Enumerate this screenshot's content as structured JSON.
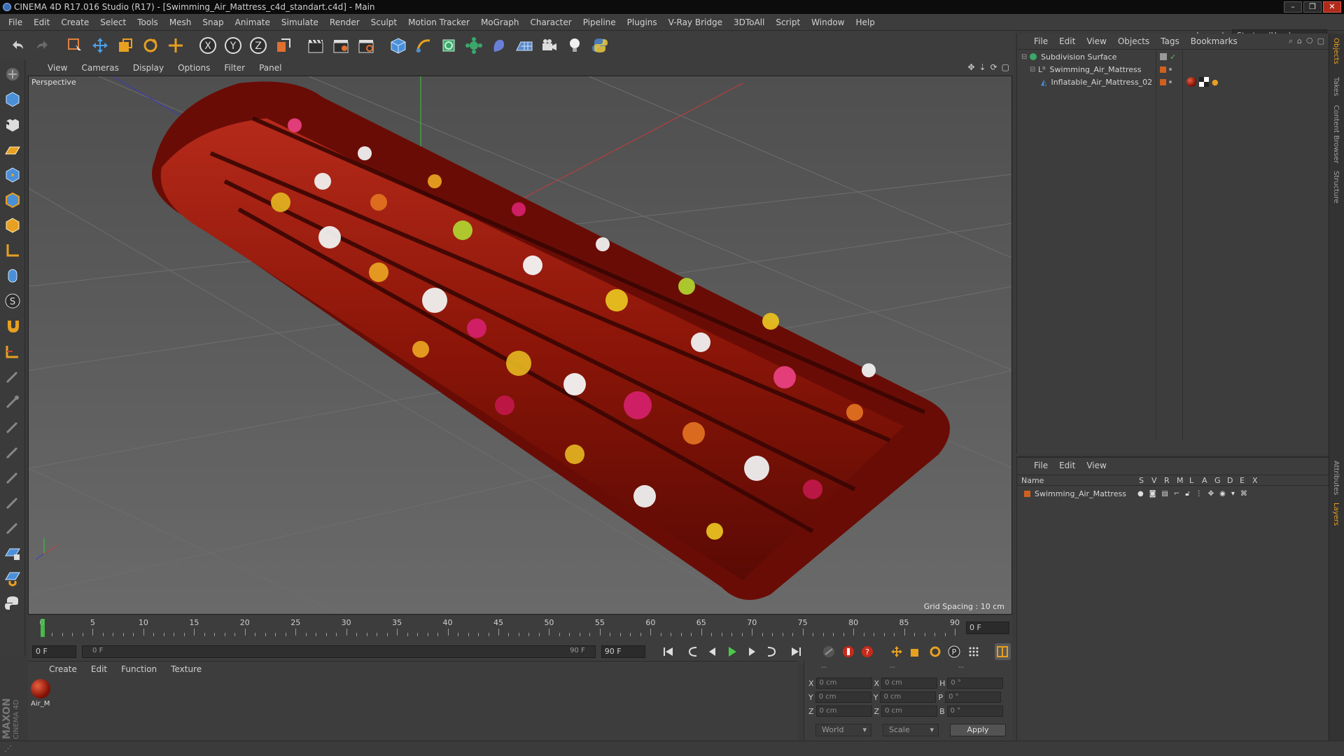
{
  "window": {
    "title": "CINEMA 4D R17.016 Studio (R17) - [Swimming_Air_Mattress_c4d_standart.c4d] - Main",
    "controls": [
      "–",
      "❐",
      "✕"
    ]
  },
  "menubar": {
    "items": [
      "File",
      "Edit",
      "Create",
      "Select",
      "Tools",
      "Mesh",
      "Snap",
      "Animate",
      "Simulate",
      "Render",
      "Sculpt",
      "Motion Tracker",
      "MoGraph",
      "Character",
      "Pipeline",
      "Plugins",
      "V-Ray Bridge",
      "3DToAll",
      "Script",
      "Window",
      "Help"
    ],
    "layout_label": "Layout:",
    "layout_value": "Startup (User)"
  },
  "viewport": {
    "menu": [
      "View",
      "Cameras",
      "Display",
      "Options",
      "Filter",
      "Panel"
    ],
    "label": "Perspective",
    "grid_spacing": "Grid Spacing : 10 cm"
  },
  "timeline": {
    "ticks": [
      "0",
      "5",
      "10",
      "15",
      "20",
      "25",
      "30",
      "35",
      "40",
      "45",
      "50",
      "55",
      "60",
      "65",
      "70",
      "75",
      "80",
      "85",
      "90"
    ],
    "current_frame": "0 F"
  },
  "transport": {
    "start_field": "0 F",
    "range_start": "0 F",
    "range_end": "90 F",
    "end_field": "90 F"
  },
  "material_panel": {
    "menu": [
      "Create",
      "Edit",
      "Function",
      "Texture"
    ],
    "material_name": "Air_M"
  },
  "coords": {
    "header": [
      "--",
      "--",
      "--"
    ],
    "rows": [
      {
        "a": "X",
        "av": "0 cm",
        "b": "X",
        "bv": "0 cm",
        "c": "H",
        "cv": "0 °"
      },
      {
        "a": "Y",
        "av": "0 cm",
        "b": "Y",
        "bv": "0 cm",
        "c": "P",
        "cv": "0 °"
      },
      {
        "a": "Z",
        "av": "0 cm",
        "b": "Z",
        "bv": "0 cm",
        "c": "B",
        "cv": "0 °"
      }
    ],
    "world": "World",
    "scale": "Scale",
    "apply": "Apply"
  },
  "object_manager": {
    "menu": [
      "File",
      "Edit",
      "View",
      "Objects",
      "Tags",
      "Bookmarks"
    ],
    "objects": [
      "Subdivision Surface",
      "Swimming_Air_Mattress",
      "Inflatable_Air_Mattress_02"
    ]
  },
  "layer_manager": {
    "menu": [
      "File",
      "Edit",
      "View"
    ],
    "columns": [
      "Name",
      "S",
      "V",
      "R",
      "M",
      "L",
      "A",
      "G",
      "D",
      "E",
      "X"
    ],
    "layers": [
      "Swimming_Air_Mattress"
    ]
  },
  "right_tabs": [
    "Objects",
    "Takes",
    "Content Browser",
    "Structure",
    "Attributes",
    "Layers"
  ],
  "logo": {
    "line1": "MAXON",
    "line2": "CINEMA 4D"
  },
  "colors": {
    "accent": "#d06020",
    "axis_x": "#c83a3a",
    "axis_y": "#3ac83a",
    "axis_z": "#3a3ac8",
    "mattress": "#8c1a10"
  }
}
